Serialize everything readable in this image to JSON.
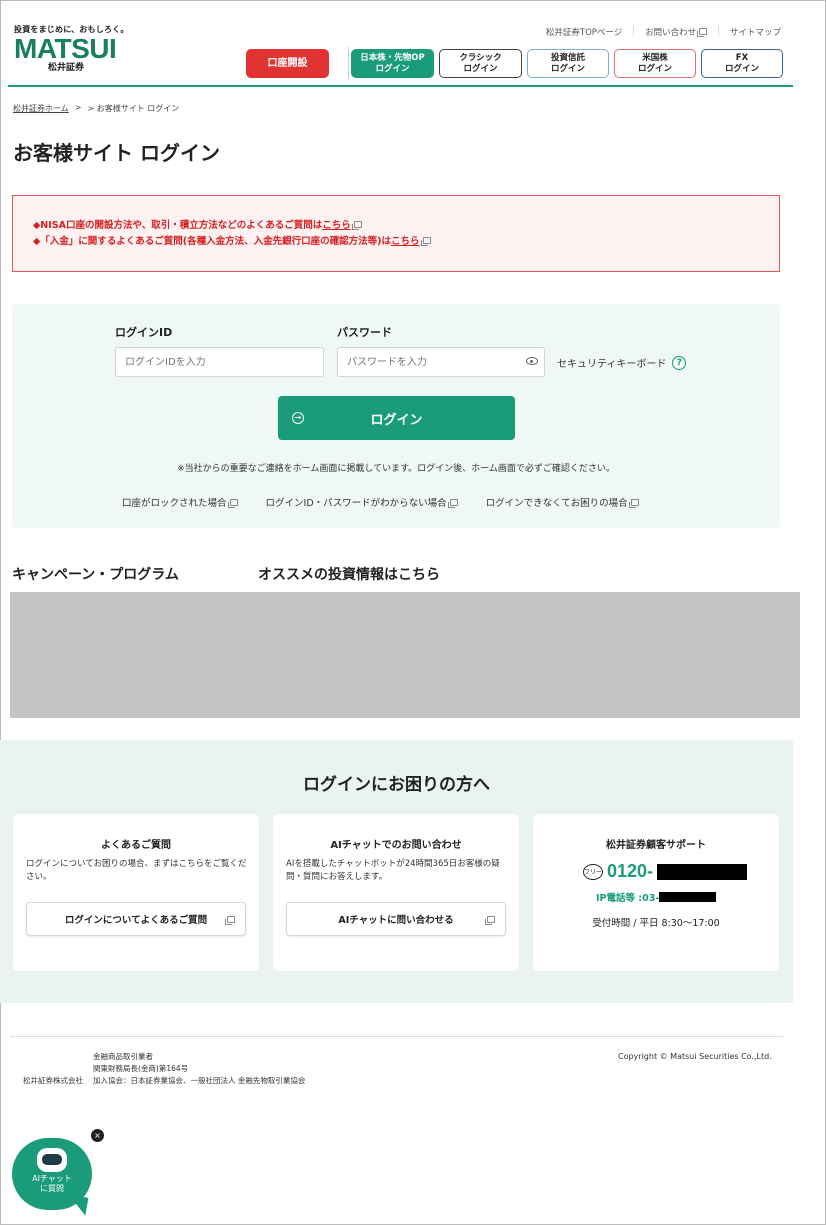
{
  "header": {
    "tagline": "投資をまじめに、おもしろく。",
    "brand": "MATSUI",
    "brand_jp": "松井証券",
    "toplinks": [
      "松井証券TOPページ",
      "お問い合わせ",
      "サイトマップ"
    ],
    "nav": {
      "open_account": "口座開設",
      "jp_stock": "日本株・先物OP\nログイン",
      "classic": "クラシック\nログイン",
      "trust": "投資信託\nログイン",
      "us_stock": "米国株\nログイン",
      "fx": "FX\nログイン"
    }
  },
  "breadcrumb": {
    "home": "松井証券ホーム",
    "sep": ">",
    "current": "> お客様サイト ログイン"
  },
  "page_title": "お客様サイト ログイン",
  "notice": {
    "line1": "◆NISA口座の開設方法や、取引・積立方法などのよくあるご質問は",
    "line2": "◆「入金」に関するよくあるご質問(各種入金方法、入金先銀行口座の確認方法等)は",
    "link": "こちら"
  },
  "login": {
    "id_label": "ログインID",
    "id_placeholder": "ログインIDを入力",
    "pw_label": "パスワード",
    "pw_placeholder": "パスワードを入力",
    "keyboard": "セキュリティキーボード",
    "help_glyph": "?",
    "button": "ログイン",
    "note": "※当社からの重要なご連絡をホーム画面に掲載しています。ログイン後、ホーム画面で必ずご確認ください。",
    "links": [
      "口座がロックされた場合",
      "ログインID・パスワードがわからない場合",
      "ログインできなくてお困りの場合"
    ]
  },
  "sections": {
    "campaign": "キャンペーン・プログラム",
    "info": "オススメの投資情報はこちら"
  },
  "trouble": {
    "title": "ログインにお困りの方へ",
    "faq": {
      "title": "よくあるご質問",
      "desc": "ログインについてお困りの場合、まずはこちらをご覧ください。",
      "button": "ログインについてよくあるご質問"
    },
    "ai": {
      "title": "AIチャットでのお問い合わせ",
      "desc": "AIを搭載したチャットボットが24時間365日お客様の疑問・質問にお答えします。",
      "button": "AIチャットに問い合わせる"
    },
    "support": {
      "title": "松井証券顧客サポート",
      "phone": "0120-",
      "ip": "IP電話等 :03-",
      "hours": "受付時間 / 平日 8:30〜17:00",
      "free_label": "フリー"
    }
  },
  "footer": {
    "company": "松井証券株式会社",
    "reg": [
      "金融商品取引業者",
      "関東財務局長(金商)第164号",
      "加入協会：日本証券業協会、一般社団法人 金融先物取引業協会"
    ],
    "copyright": "Copyright © Matsui Securities Co.,Ltd."
  },
  "chatbot": {
    "label": "AIチャット\nに質問",
    "close": "×"
  }
}
